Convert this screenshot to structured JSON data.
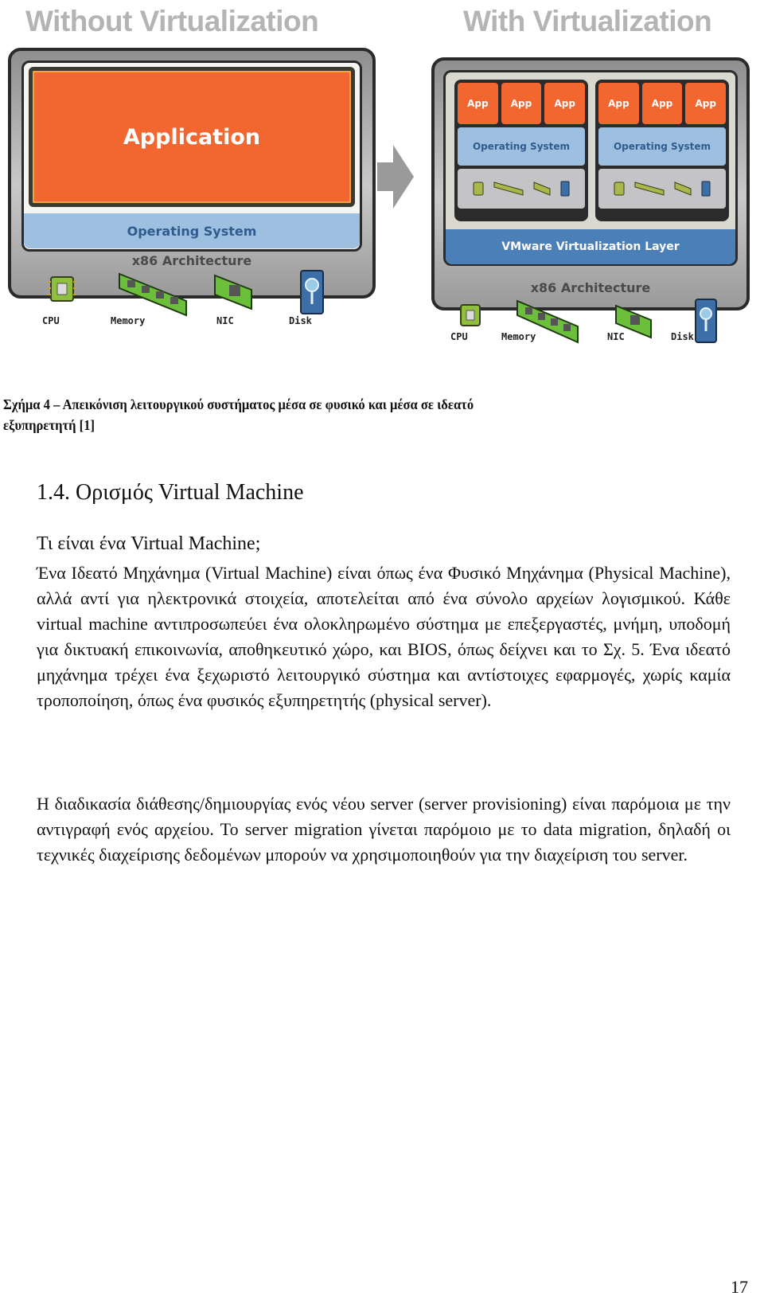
{
  "figure": {
    "left": {
      "title": "Without Virtualization",
      "application": "Application",
      "operating_system": "Operating System",
      "architecture": "x86 Architecture",
      "hardware": [
        {
          "label": "CPU",
          "icon": "cpu-icon"
        },
        {
          "label": "Memory",
          "icon": "memory-icon"
        },
        {
          "label": "NIC",
          "icon": "nic-icon"
        },
        {
          "label": "Disk",
          "icon": "disk-icon"
        }
      ]
    },
    "arrow": "arrow-right-icon",
    "right": {
      "title": "With Virtualization",
      "vms": [
        {
          "apps": [
            "App",
            "App",
            "App"
          ],
          "operating_system": "Operating System"
        },
        {
          "apps": [
            "App",
            "App",
            "App"
          ],
          "operating_system": "Operating System"
        }
      ],
      "virtualization_layer": "VMware Virtualization Layer",
      "architecture": "x86 Architecture",
      "hardware": [
        {
          "label": "CPU",
          "icon": "cpu-icon"
        },
        {
          "label": "Memory",
          "icon": "memory-icon"
        },
        {
          "label": "NIC",
          "icon": "nic-icon"
        },
        {
          "label": "Disk",
          "icon": "disk-icon"
        }
      ]
    },
    "colors": {
      "app": "#f26630",
      "os": "#9dc0e0",
      "virt_layer": "#4a7fb8",
      "title_gray": "#b4b4b4"
    }
  },
  "caption": {
    "line1": "Σχήμα 4 – Απεικόνιση λειτουργικού συστήματος μέσα σε φυσικό και μέσα σε ιδεατό",
    "line2": "εξυπηρετητή [1]"
  },
  "section": {
    "heading": "1.4. Ορισμός Virtual Machine",
    "subheading": "Τι είναι ένα Virtual Machine;",
    "paragraphs": [
      "Ένα Ιδεατό Μηχάνημα (Virtual Machine) είναι όπως ένα Φυσικό Μηχάνημα (Physical Machine), αλλά αντί για ηλεκτρονικά στοιχεία, αποτελείται από ένα σύνολο αρχείων λογισμικού. Κάθε virtual machine αντιπροσωπεύει ένα ολοκληρωμένο σύστημα με επεξεργαστές, μνήμη, υποδομή για δικτυακή επικοινωνία, αποθηκευτικό χώρο, και BIOS, όπως δείχνει και το Σχ. 5. Ένα ιδεατό μηχάνημα τρέχει ένα ξεχωριστό λειτουργικό σύστημα και αντίστοιχες εφαρμογές, χωρίς καμία τροποποίηση, όπως ένα φυσικός εξυπηρετητής (physical server).",
      "Η διαδικασία διάθεσης/δημιουργίας ενός νέου server (server provisioning) είναι παρόμοια με την αντιγραφή ενός αρχείου. Το server migration γίνεται παρόμοιο με το data migration, δηλαδή οι τεχνικές διαχείρισης δεδομένων μπορούν να χρησιμοποιηθούν για την διαχείριση του server."
    ]
  },
  "page_number": "17"
}
